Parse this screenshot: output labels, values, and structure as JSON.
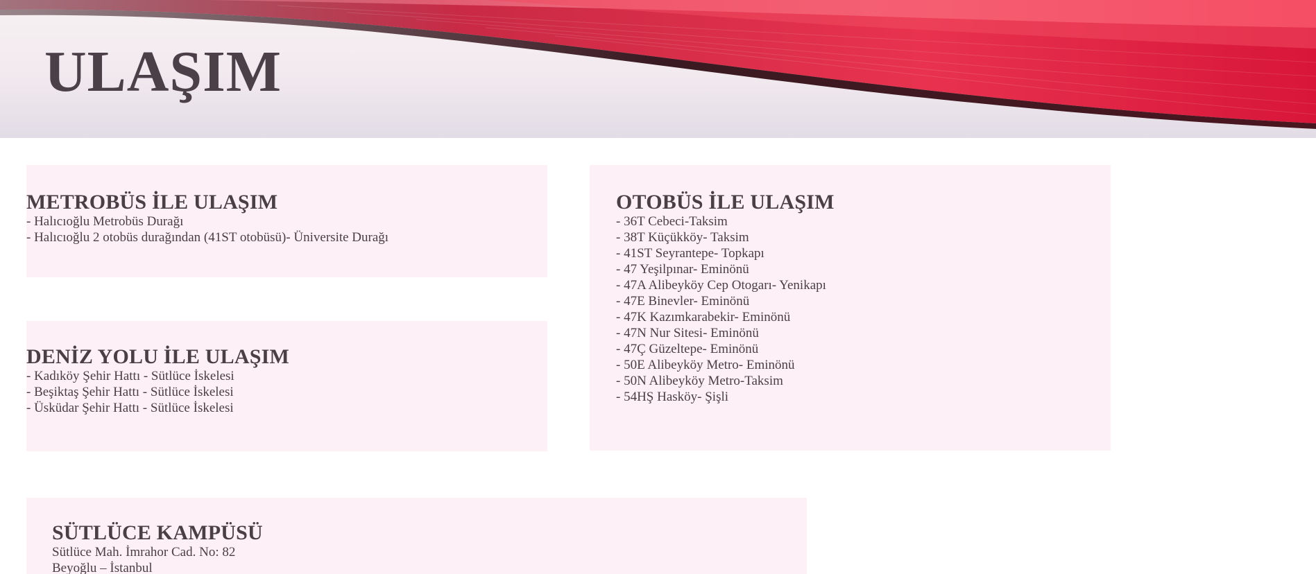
{
  "banner": {
    "title": "ULAŞIM"
  },
  "metrobus": {
    "heading": "METROBÜS İLE ULAŞIM",
    "items": [
      "- Halıcıoğlu Metrobüs Durağı",
      "- Halıcıoğlu 2 otobüs durağından (41ST otobüsü)- Üniversite Durağı"
    ]
  },
  "deniz": {
    "heading": "DENİZ YOLU İLE ULAŞIM",
    "items": [
      "- Kadıköy Şehir Hattı - Sütlüce İskelesi",
      "- Beşiktaş Şehir Hattı - Sütlüce İskelesi",
      "- Üsküdar Şehir Hattı - Sütlüce İskelesi"
    ]
  },
  "otobus": {
    "heading": "OTOBÜS İLE ULAŞIM",
    "items": [
      "- 36T Cebeci-Taksim",
      "- 38T Küçükköy- Taksim",
      "- 41ST Seyrantepe- Topkapı",
      "- 47 Yeşilpınar- Eminönü",
      "- 47A Alibeyköy Cep Otogarı- Yenikapı",
      "- 47E Binevler- Eminönü",
      "- 47K Kazımkarabekir- Eminönü",
      "- 47N Nur Sitesi- Eminönü",
      "- 47Ç Güzeltepe- Eminönü",
      "- 50E Alibeyköy Metro- Eminönü",
      "- 50N Alibeyköy Metro-Taksim",
      "- 54HŞ Hasköy- Şişli"
    ]
  },
  "kampus": {
    "heading": "SÜTLÜCE KAMPÜSÜ",
    "address_line1": "Sütlüce Mah. İmrahor Cad. No: 82",
    "address_line2": "Beyoğlu – İstanbul"
  },
  "colors": {
    "panel_bg": "#fdf0f6",
    "text": "#4a3f45",
    "banner_red": "#e02040",
    "banner_dark": "#3a1a22"
  }
}
